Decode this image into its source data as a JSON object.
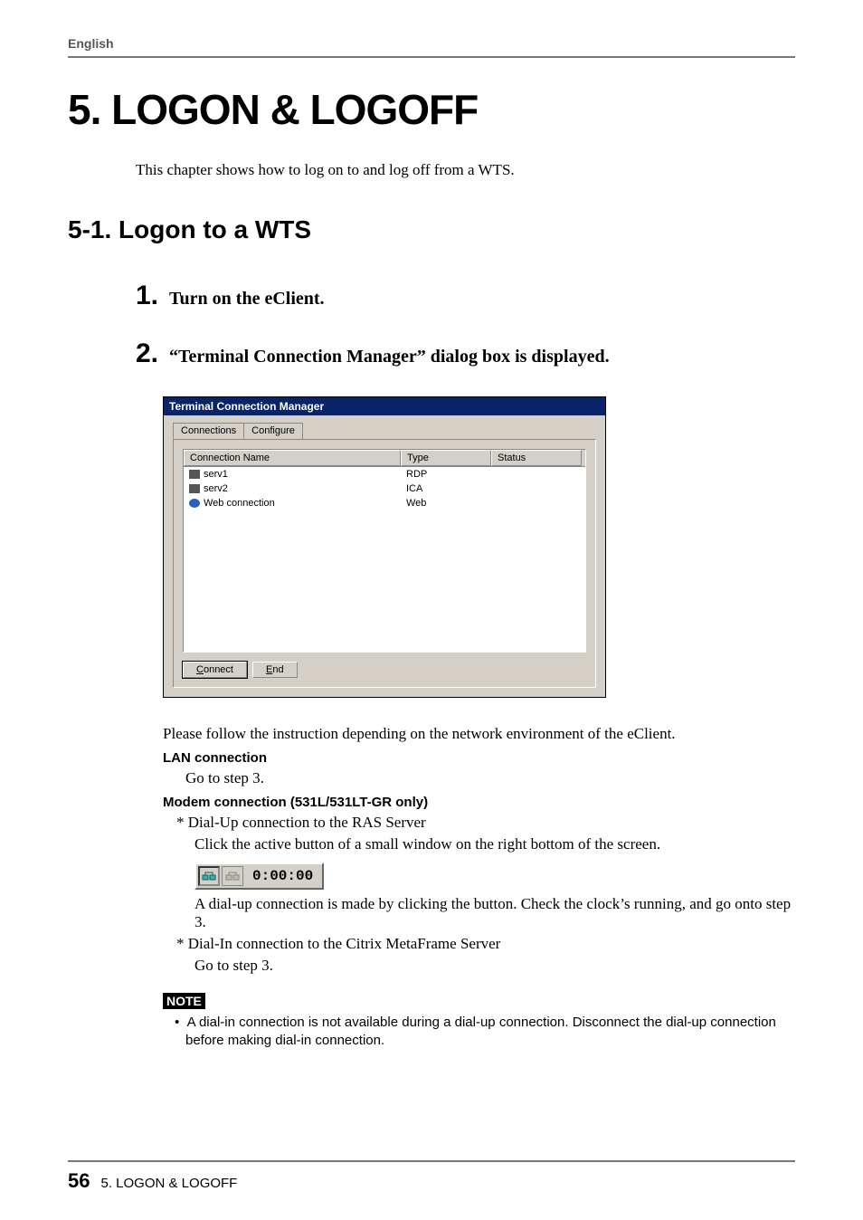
{
  "header": {
    "language": "English"
  },
  "chapter": {
    "title": "5. LOGON & LOGOFF",
    "intro": "This chapter shows how to log on to and log off from a WTS."
  },
  "section": {
    "title": "5-1. Logon to a WTS"
  },
  "steps": [
    {
      "num": "1.",
      "text": "Turn on the eClient."
    },
    {
      "num": "2.",
      "text": "“Terminal Connection Manager” dialog box is displayed."
    }
  ],
  "dialog": {
    "title": "Terminal Connection Manager",
    "tabs": {
      "connections": "Connections",
      "configure": "Configure"
    },
    "columns": {
      "name": "Connection Name",
      "type": "Type",
      "status": "Status"
    },
    "rows": [
      {
        "name": "serv1",
        "type": "RDP",
        "icon": "pc"
      },
      {
        "name": "serv2",
        "type": "ICA",
        "icon": "pc"
      },
      {
        "name": "Web connection",
        "type": "Web",
        "icon": "ie"
      }
    ],
    "buttons": {
      "connect": "Connect",
      "end": "End"
    }
  },
  "body": {
    "follow": "Please follow the instruction depending on the network environment of the eClient.",
    "lan_label": "LAN connection",
    "lan_goto": "Go to step 3.",
    "modem_label": "Modem connection (531L/531LT-GR only)",
    "dialup_bullet": "*  Dial-Up connection to the RAS Server",
    "dialup_click": "Click the active button of a small window on the right bottom of the screen.",
    "tray_time": "0:00:00",
    "dialup_made": "A dial-up connection is made by clicking the button.  Check the clock’s running, and go onto step 3.",
    "dialin_bullet": "*  Dial-In connection to the Citrix MetaFrame Server",
    "dialin_goto": "Go to step 3."
  },
  "note": {
    "tag": "NOTE",
    "text": "A dial-in connection is not available during a dial-up connection.  Disconnect the dial-up connection before making dial-in connection."
  },
  "footer": {
    "page": "56",
    "text": "5. LOGON & LOGOFF"
  }
}
